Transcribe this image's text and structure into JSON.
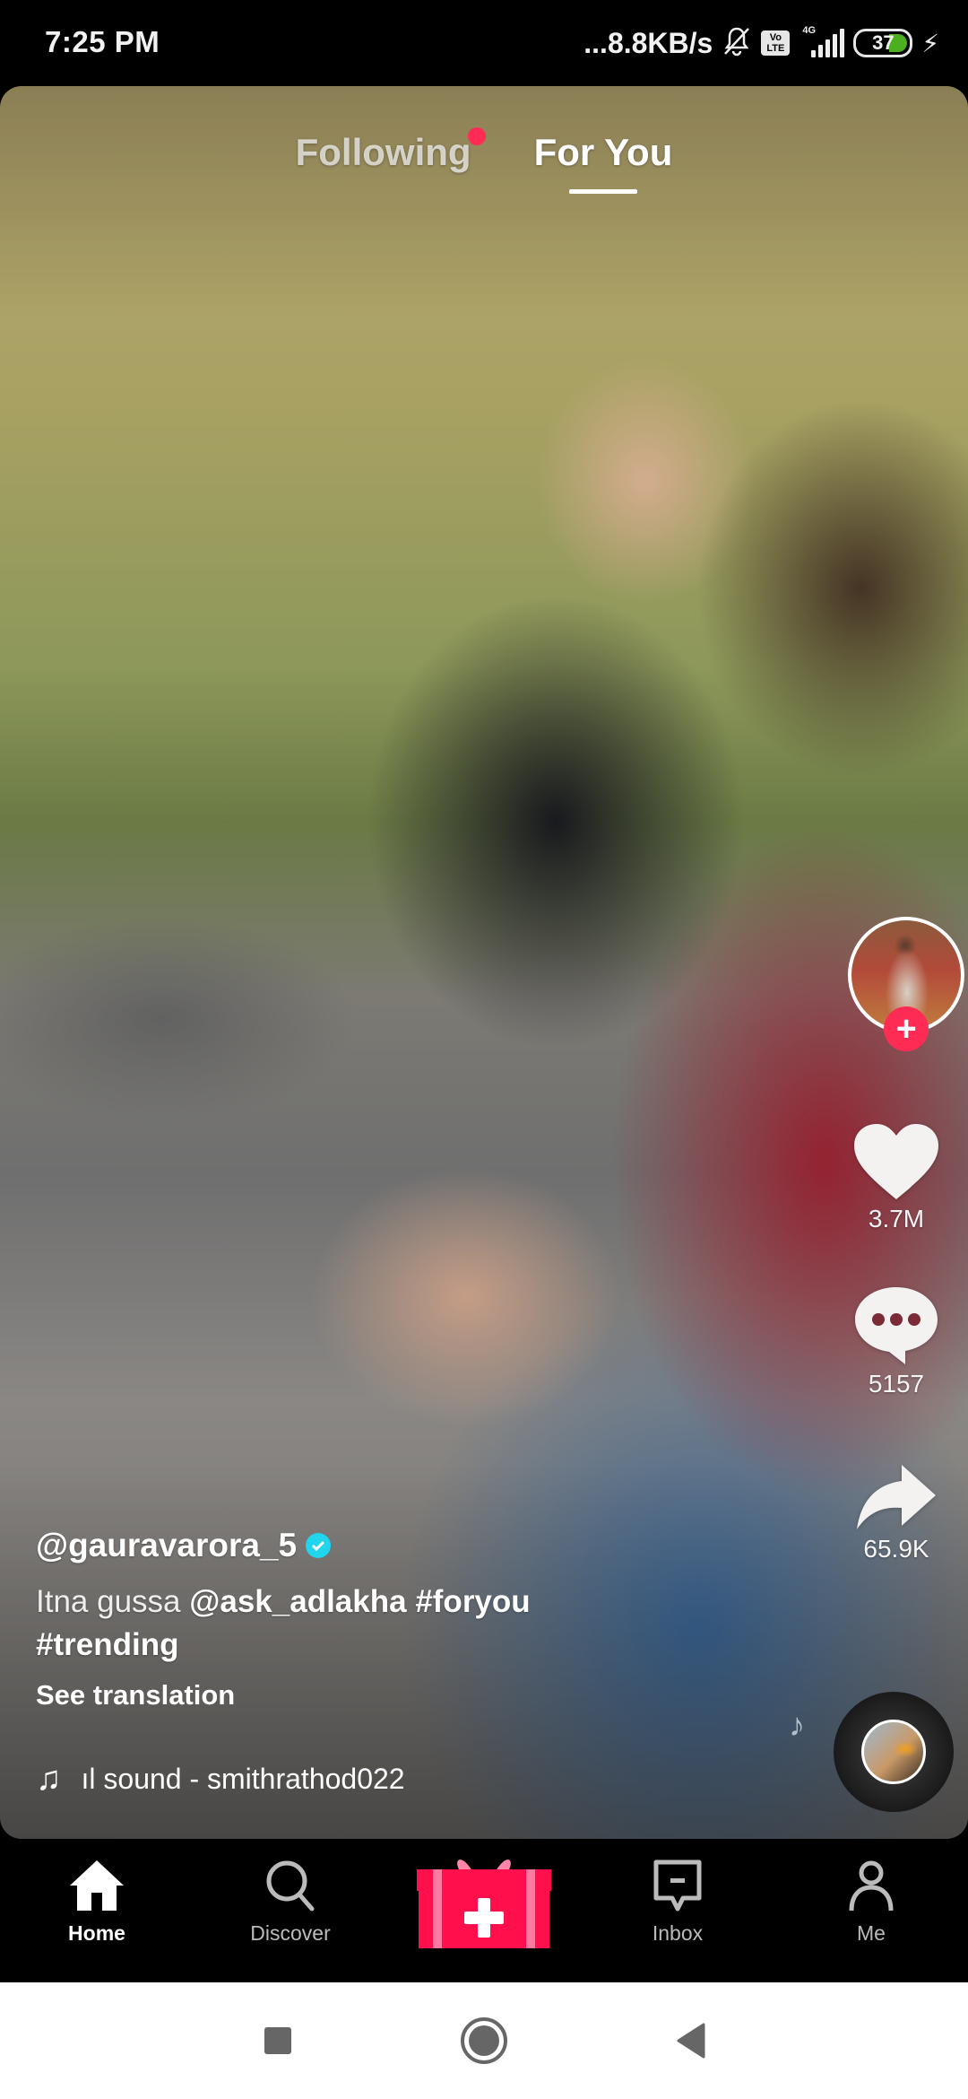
{
  "status_bar": {
    "time": "7:25 PM",
    "net_speed": "...8.8KB/s",
    "volte_top": "Vo",
    "volte_bottom": "LTE",
    "network_type": "4G",
    "battery_percent": "37",
    "icons": [
      "mute-bell-icon",
      "volte-icon",
      "signal-icon",
      "battery-icon",
      "charging-bolt-icon"
    ]
  },
  "top_tabs": {
    "following": "Following",
    "for_you": "For You",
    "active": "For You",
    "following_has_notification": true
  },
  "actions": {
    "likes": "3.7M",
    "comments": "5157",
    "shares": "65.9K",
    "follow_plus": "+"
  },
  "post": {
    "username": "@gauravarora_5",
    "verified": true,
    "caption_text": "Itna gussa",
    "mention": "@ask_adlakha",
    "hashtag_1": "#foryou",
    "hashtag_2": "#trending",
    "see_translation": "See translation",
    "music": "ıl sound - smithrathod022",
    "floating_note": "♪"
  },
  "bottom_nav": {
    "items": [
      {
        "label": "Home",
        "icon": "home-icon",
        "active": true
      },
      {
        "label": "Discover",
        "icon": "search-icon",
        "active": false
      },
      {
        "label": "",
        "icon": "gift-create-icon",
        "active": false
      },
      {
        "label": "Inbox",
        "icon": "inbox-icon",
        "active": false
      },
      {
        "label": "Me",
        "icon": "profile-icon",
        "active": false
      }
    ]
  },
  "colors": {
    "accent": "#fe2c55",
    "verified": "#20d5ec",
    "battery_fill": "#4caf1f"
  }
}
